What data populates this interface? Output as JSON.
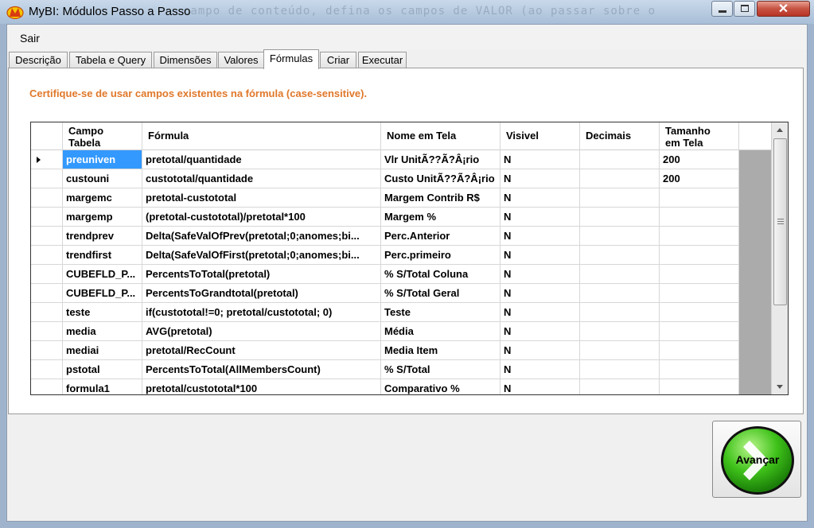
{
  "window": {
    "title": "MyBI: Módulos Passo a Passo",
    "background_text": "campo de conteúdo, defina os campos de VALOR (ao passar sobre o",
    "close_label": "✕"
  },
  "menu": {
    "sair": "Sair"
  },
  "tabs": [
    {
      "label": "Descrição"
    },
    {
      "label": "Tabela e Query"
    },
    {
      "label": "Dimensões"
    },
    {
      "label": "Valores"
    },
    {
      "label": "Fórmulas"
    },
    {
      "label": "Criar"
    },
    {
      "label": "Executar"
    }
  ],
  "active_tab": "Fórmulas",
  "hint": "Certifique-se de usar campos existentes na fórmula (case-sensitive).",
  "grid": {
    "columns": [
      {
        "line1": "Campo",
        "line2": "Tabela"
      },
      {
        "line1": "Fórmula",
        "line2": ""
      },
      {
        "line1": "Nome em Tela",
        "line2": ""
      },
      {
        "line1": "Visivel",
        "line2": ""
      },
      {
        "line1": "Decimais",
        "line2": ""
      },
      {
        "line1": "Tamanho",
        "line2": "em Tela"
      }
    ],
    "rows": [
      {
        "campo": "preuniven",
        "formula": "pretotal/quantidade",
        "nome": "Vlr UnitÃ??Ã?Â¡rio",
        "visivel": "N",
        "decimais": "",
        "tamanho": "200"
      },
      {
        "campo": "custouni",
        "formula": "custototal/quantidade",
        "nome": "Custo UnitÃ??Ã?Â¡rio",
        "visivel": "N",
        "decimais": "",
        "tamanho": "200"
      },
      {
        "campo": "margemc",
        "formula": "pretotal-custototal",
        "nome": "Margem Contrib R$",
        "visivel": "N",
        "decimais": "",
        "tamanho": ""
      },
      {
        "campo": "margemp",
        "formula": "(pretotal-custototal)/pretotal*100",
        "nome": "Margem %",
        "visivel": "N",
        "decimais": "",
        "tamanho": ""
      },
      {
        "campo": "trendprev",
        "formula": "Delta(SafeValOfPrev(pretotal;0;anomes;bi...",
        "nome": "Perc.Anterior",
        "visivel": "N",
        "decimais": "",
        "tamanho": ""
      },
      {
        "campo": "trendfirst",
        "formula": "Delta(SafeValOfFirst(pretotal;0;anomes;bi...",
        "nome": "Perc.primeiro",
        "visivel": "N",
        "decimais": "",
        "tamanho": ""
      },
      {
        "campo": "CUBEFLD_P...",
        "formula": "PercentsToTotal(pretotal)",
        "nome": "% S/Total Coluna",
        "visivel": "N",
        "decimais": "",
        "tamanho": ""
      },
      {
        "campo": "CUBEFLD_P...",
        "formula": "PercentsToGrandtotal(pretotal)",
        "nome": "% S/Total Geral",
        "visivel": "N",
        "decimais": "",
        "tamanho": ""
      },
      {
        "campo": "teste",
        "formula": "if(custototal!=0; pretotal/custototal; 0)",
        "nome": "Teste",
        "visivel": "N",
        "decimais": "",
        "tamanho": ""
      },
      {
        "campo": "media",
        "formula": "AVG(pretotal)",
        "nome": "Média",
        "visivel": "N",
        "decimais": "",
        "tamanho": ""
      },
      {
        "campo": "mediai",
        "formula": "pretotal/RecCount",
        "nome": "Media Item",
        "visivel": "N",
        "decimais": "",
        "tamanho": ""
      },
      {
        "campo": "pstotal",
        "formula": "PercentsToTotal(AllMembersCount)",
        "nome": "% S/Total",
        "visivel": "N",
        "decimais": "",
        "tamanho": ""
      },
      {
        "campo": "formula1",
        "formula": "pretotal/custototal*100",
        "nome": "Comparativo %",
        "visivel": "N",
        "decimais": "",
        "tamanho": ""
      }
    ]
  },
  "advance_button": {
    "label": "Avançar"
  }
}
